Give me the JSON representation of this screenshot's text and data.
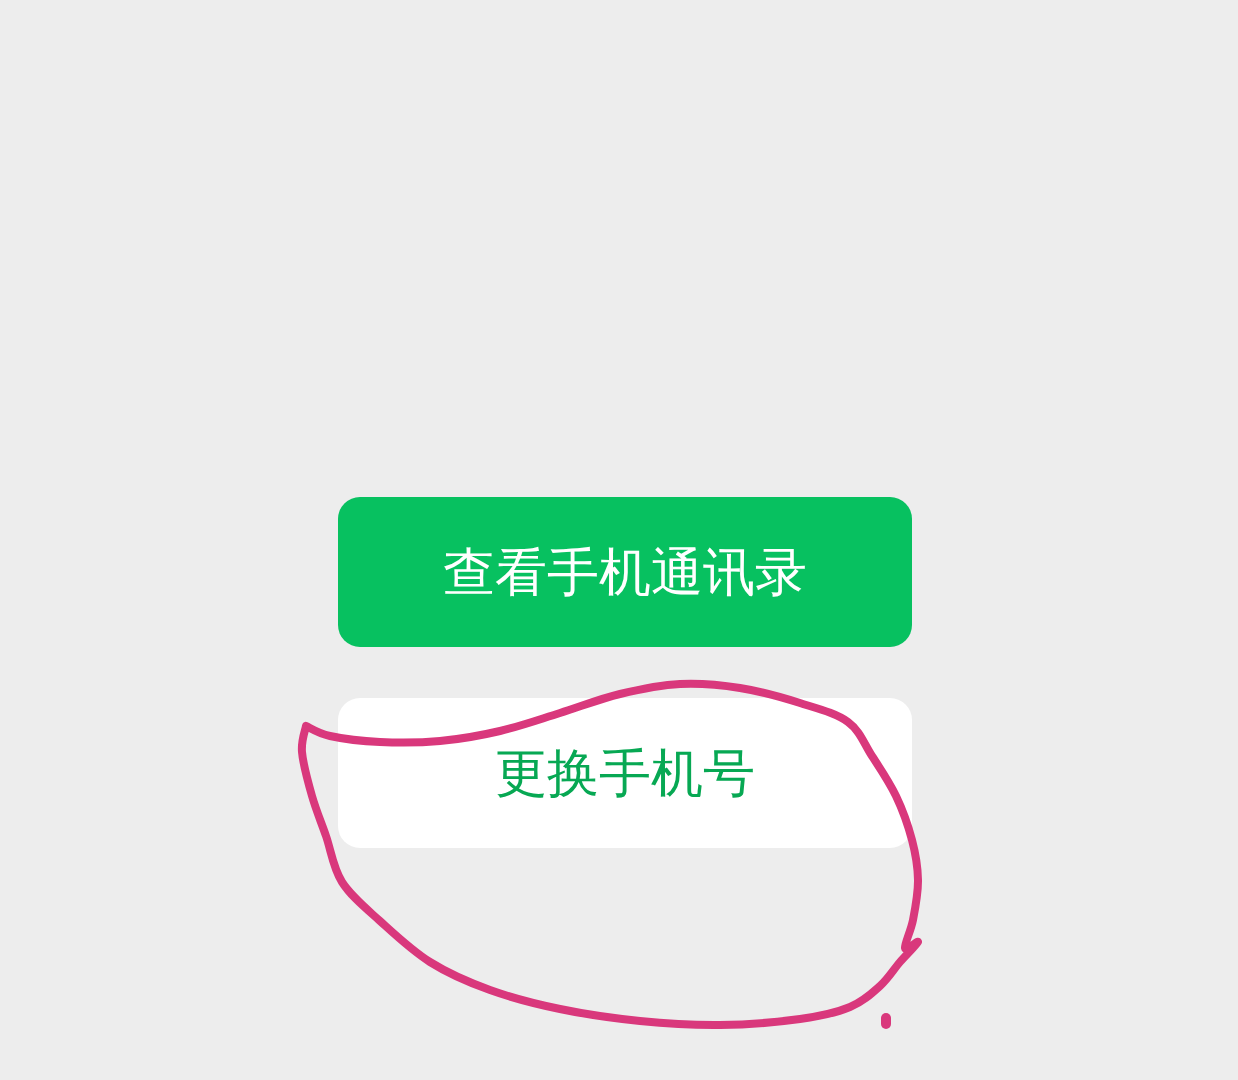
{
  "buttons": [
    {
      "label": "查看手机通讯录",
      "kind": "primary"
    },
    {
      "label": "更换手机号",
      "kind": "secondary"
    }
  ]
}
